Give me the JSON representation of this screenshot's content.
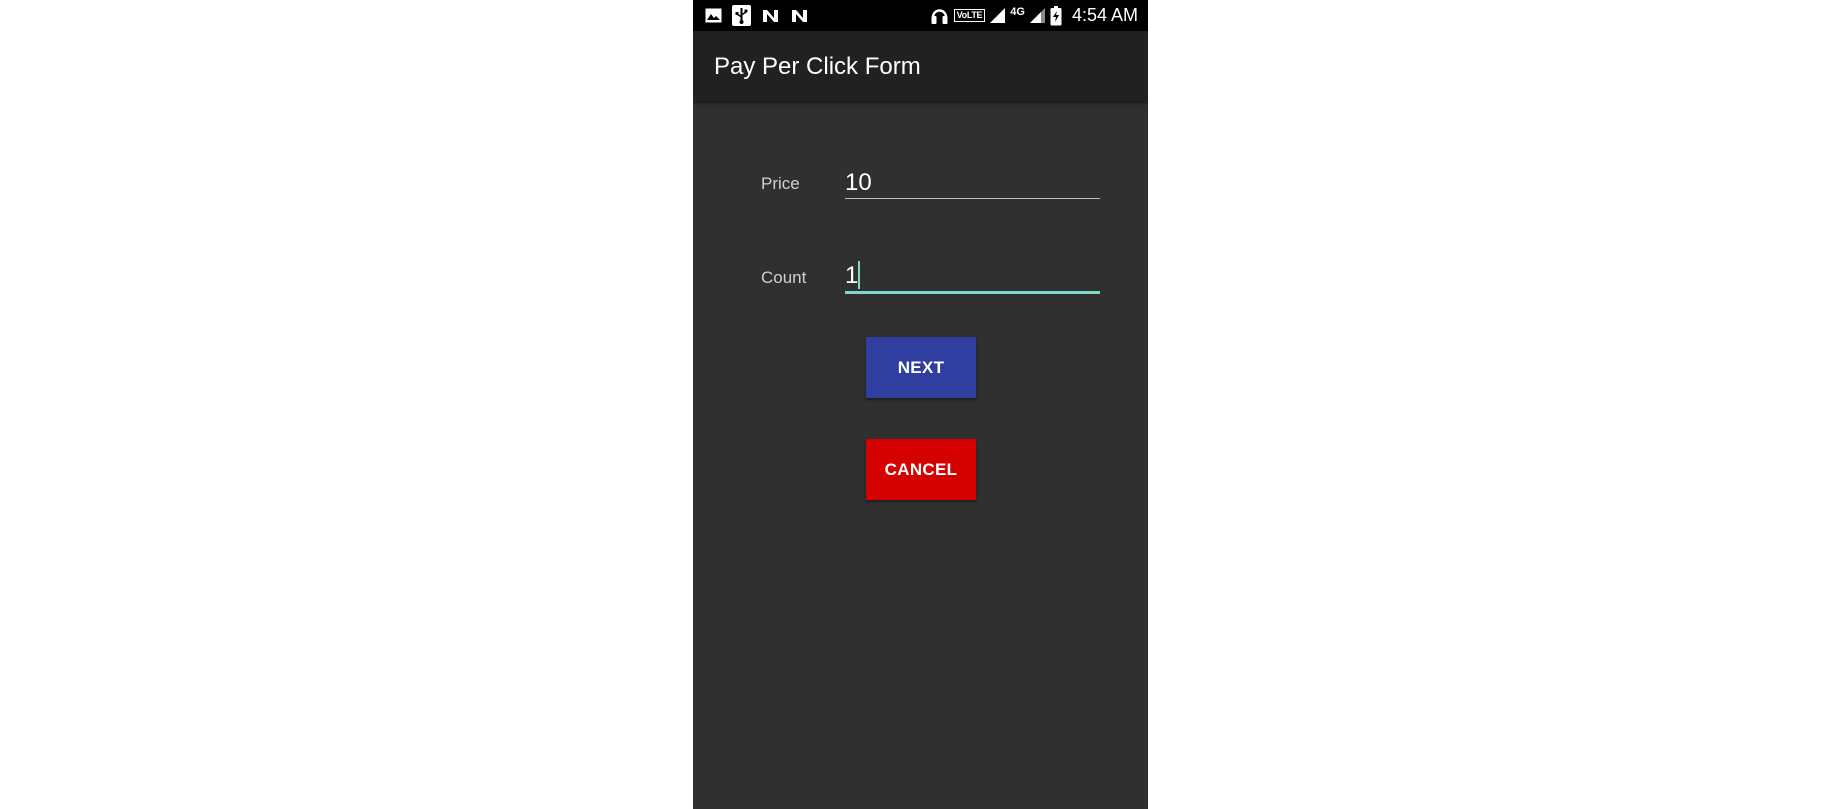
{
  "status_bar": {
    "left_icons": [
      "image-icon",
      "usb-icon",
      "n-notification-icon",
      "n-notification-icon"
    ],
    "right_icons": [
      "headphones-icon",
      "volte-badge",
      "signal-icon",
      "network-4g-label",
      "signal-icon",
      "battery-charging-icon"
    ],
    "volte_label": "VoLTE",
    "network_label": "4G",
    "time": "4:54 AM"
  },
  "app_bar": {
    "title": "Pay Per Click Form"
  },
  "form": {
    "price": {
      "label": "Price",
      "value": "10"
    },
    "count": {
      "label": "Count",
      "value": "1",
      "focused": true
    }
  },
  "buttons": {
    "next_label": "NEXT",
    "cancel_label": "CANCEL"
  },
  "colors": {
    "background": "#303030",
    "app_bar": "#212121",
    "status_bar": "#000000",
    "accent": "#7fd9c8",
    "next_button": "#303f9f",
    "cancel_button": "#d50000"
  }
}
